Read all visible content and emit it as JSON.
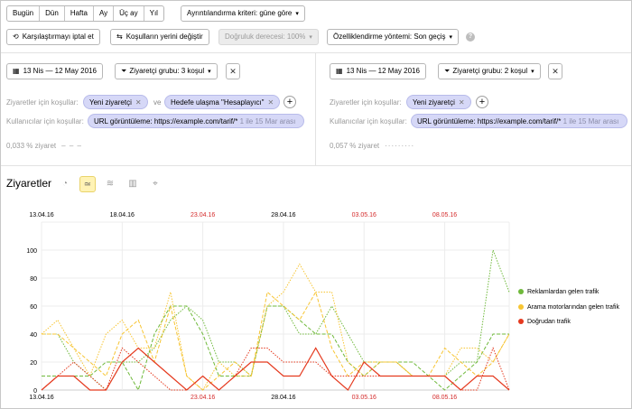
{
  "toolbar": {
    "periods": [
      "Bugün",
      "Dün",
      "Hafta",
      "Ay",
      "Üç ay",
      "Yıl"
    ],
    "detail_label": "Ayrıntılandırma kriteri: güne göre",
    "cancel_compare_label": "Karşılaştırmayı iptal et",
    "swap_label": "Koşulların yerini değiştir",
    "accuracy_label": "Doğruluk derecesi: 100%",
    "attribution_label": "Özelliklendirme yöntemi: Son geçiş",
    "help": "?"
  },
  "segments": [
    {
      "date_range": "13 Nis — 12 May 2016",
      "group": "Ziyaretçi grubu: 3 koşul",
      "visits_label": "Ziyaretler için koşullar:",
      "visit_tags": [
        "Yeni ziyaretçi",
        "Hedefe ulaşma \"Hesaplayıcı\""
      ],
      "and_word": "ve",
      "users_label": "Kullanıcılar için koşullar:",
      "user_tag": "URL görüntüleme: https://example.com/tarif/*",
      "user_tag_note": "1 ile 15 Mar arası",
      "metric": "0,033 % ziyaret",
      "metric_line": "– – –"
    },
    {
      "date_range": "13 Nis — 12 May 2016",
      "group": "Ziyaretçi grubu: 2 koşul",
      "visits_label": "Ziyaretler için koşullar:",
      "visit_tags": [
        "Yeni ziyaretçi"
      ],
      "users_label": "Kullanıcılar için koşullar:",
      "user_tag": "URL görüntüleme: https://example.com/tarif/*",
      "user_tag_note": "1 ile 15 Mar arası",
      "metric": "0,057 % ziyaret",
      "metric_line": "·········"
    }
  ],
  "chart_section": {
    "title": "Ziyaretler"
  },
  "icons": {
    "calendar": "calendar-icon",
    "filter": "filter-icon",
    "close": "close-icon",
    "plus": "plus-icon",
    "refresh": "refresh-icon",
    "swap": "swap-icon",
    "views": [
      "pie-chart-icon",
      "line-chart-icon",
      "area-chart-icon",
      "bar-chart-icon",
      "map-icon"
    ]
  },
  "colors": {
    "green": "#6fb93b",
    "yellow": "#f7c533",
    "red": "#e53a1f",
    "pill": "#d6d8f7",
    "active_view": "#fff3b5"
  },
  "chart_data": {
    "type": "line",
    "top_ticks": [
      {
        "index": 0,
        "label": "13.04.16",
        "weekend": false
      },
      {
        "index": 5,
        "label": "18.04.16",
        "weekend": false
      },
      {
        "index": 10,
        "label": "23.04.16",
        "weekend": true
      },
      {
        "index": 15,
        "label": "28.04.16",
        "weekend": false
      },
      {
        "index": 20,
        "label": "03.05.16",
        "weekend": true
      },
      {
        "index": 25,
        "label": "08.05.16",
        "weekend": true
      }
    ],
    "bottom_ticks": [
      {
        "index": 0,
        "label": "13.04.16",
        "weekend": false
      },
      {
        "index": 10,
        "label": "23.04.16",
        "weekend": true
      },
      {
        "index": 15,
        "label": "28.04.16",
        "weekend": false
      },
      {
        "index": 20,
        "label": "03.05.16",
        "weekend": true
      },
      {
        "index": 25,
        "label": "08.05.16",
        "weekend": true
      }
    ],
    "y_ticks": [
      0,
      20,
      40,
      60,
      80,
      100
    ],
    "ylim": [
      0,
      120
    ],
    "n_points": 30,
    "series": [
      {
        "name": "Reklamlardan gelen trafik",
        "color": "#6fb93b",
        "style": "dashed",
        "values": [
          10,
          10,
          10,
          10,
          20,
          20,
          0,
          40,
          60,
          60,
          40,
          10,
          10,
          10,
          60,
          60,
          50,
          40,
          40,
          20,
          10,
          20,
          20,
          20,
          10,
          0,
          10,
          20,
          40,
          40
        ]
      },
      {
        "name": "Reklamlardan gelen trafik",
        "color": "#6fb93b",
        "style": "dotted",
        "values": [
          40,
          40,
          20,
          10,
          0,
          20,
          20,
          30,
          50,
          60,
          50,
          20,
          20,
          10,
          60,
          60,
          40,
          40,
          60,
          40,
          20,
          20,
          20,
          10,
          10,
          10,
          20,
          20,
          100,
          70
        ]
      },
      {
        "name": "Arama motorlarından gelen trafik",
        "color": "#f7c533",
        "style": "dashed",
        "values": [
          40,
          40,
          30,
          20,
          10,
          40,
          50,
          20,
          60,
          10,
          0,
          10,
          20,
          10,
          70,
          60,
          50,
          70,
          30,
          10,
          20,
          20,
          20,
          10,
          10,
          30,
          20,
          10,
          20,
          40
        ]
      },
      {
        "name": "Arama motorlarından gelen trafik",
        "color": "#f7c533",
        "style": "dotted",
        "values": [
          40,
          50,
          30,
          10,
          40,
          50,
          30,
          30,
          70,
          10,
          0,
          20,
          10,
          10,
          60,
          70,
          90,
          70,
          70,
          20,
          10,
          20,
          20,
          10,
          10,
          10,
          30,
          30,
          20,
          40
        ]
      },
      {
        "name": "Doğrudan trafik",
        "color": "#e53a1f",
        "style": "solid",
        "values": [
          0,
          10,
          10,
          0,
          0,
          20,
          30,
          20,
          10,
          0,
          10,
          0,
          10,
          20,
          20,
          10,
          10,
          30,
          10,
          0,
          20,
          10,
          10,
          10,
          10,
          10,
          0,
          10,
          10,
          0
        ]
      },
      {
        "name": "Doğrudan trafik",
        "color": "#e53a1f",
        "style": "dotted",
        "values": [
          0,
          10,
          20,
          10,
          0,
          30,
          20,
          10,
          0,
          0,
          10,
          0,
          10,
          30,
          30,
          20,
          20,
          20,
          10,
          10,
          10,
          10,
          10,
          10,
          10,
          10,
          0,
          0,
          30,
          0
        ]
      }
    ],
    "legend": [
      {
        "label": "Reklamlardan gelen trafik",
        "color": "#6fb93b"
      },
      {
        "label": "Arama motorlarından gelen trafik",
        "color": "#f7c533"
      },
      {
        "label": "Doğrudan trafik",
        "color": "#e53a1f"
      }
    ],
    "legend_position": "right"
  }
}
